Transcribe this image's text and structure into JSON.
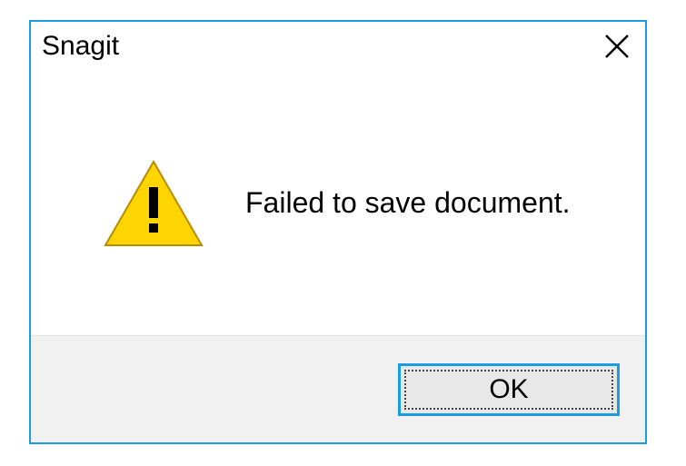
{
  "dialog": {
    "title": "Snagit",
    "message": "Failed to save document.",
    "ok_label": "OK"
  }
}
